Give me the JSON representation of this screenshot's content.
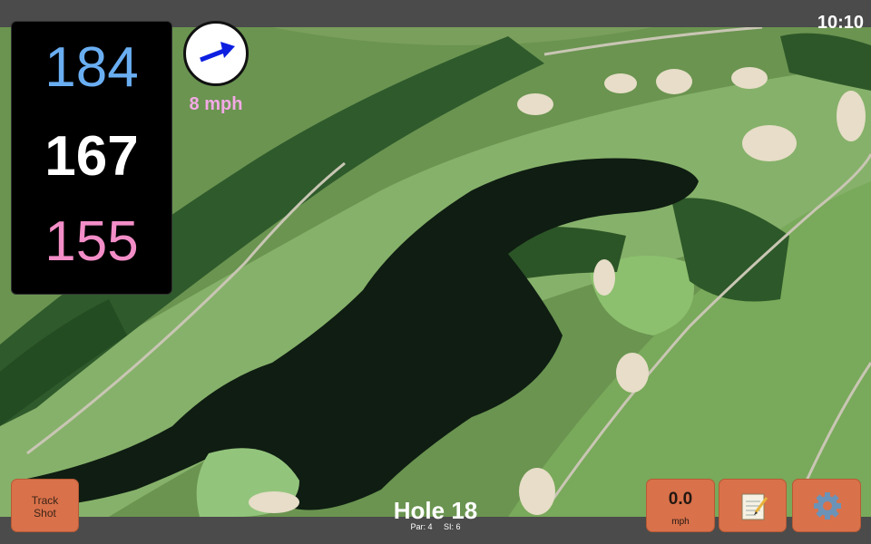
{
  "status": {
    "time": "10:10"
  },
  "yardage": {
    "back": "184",
    "middle": "167",
    "front": "155"
  },
  "wind": {
    "speed": "8 mph",
    "icon": "wind-arrow-icon",
    "arrow_color": "#0c1fe0"
  },
  "track_shot": {
    "label_line1": "Track",
    "label_line2": "Shot"
  },
  "speed_display": {
    "value": "0.0",
    "unit": "mph"
  },
  "notes_button": {
    "icon": "notepad-icon"
  },
  "settings_button": {
    "icon": "gear-icon"
  },
  "hole": {
    "title": "Hole 18",
    "par": "Par: 4",
    "si": "SI: 6"
  },
  "colors": {
    "button": "#d9714a",
    "back_yardage": "#6aaef2",
    "front_yardage": "#f38dc7",
    "wind_text": "#f4a9e6"
  }
}
